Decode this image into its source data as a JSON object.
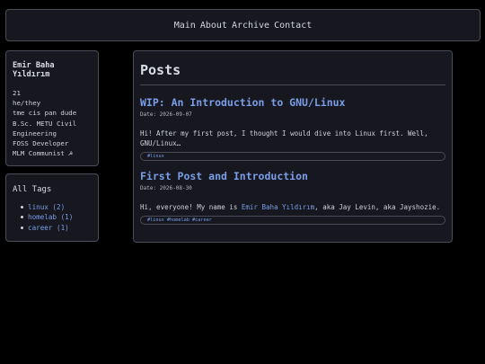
{
  "nav": {
    "links": [
      "Main",
      "About",
      "Archive",
      "Contact"
    ]
  },
  "profile": {
    "name": "Emir Baha Yıldırım",
    "lines": [
      "21",
      "he/they",
      "tme cis pan dude",
      "B.Sc. METU Civil",
      "Engineering",
      "FOSS Developer",
      "MLM Communist ☭"
    ]
  },
  "tags": {
    "heading": "All Tags",
    "items": [
      "linux (2)",
      "homelab (1)",
      "career (1)"
    ]
  },
  "main": {
    "title": "Posts",
    "posts": [
      {
        "title": "WIP: An Introduction to GNU/Linux",
        "date": "Date: 2026-09-07",
        "excerpt": "Hi! After my first post, I thought I would dive into Linux first. Well, GNU/Linux…",
        "tags": "#linux"
      },
      {
        "title": "First Post and Introduction",
        "date": "Date: 2026-08-30",
        "excerpt_before": "Hi, everyone! My name is ",
        "excerpt_link": "Emir Baha Yıldırım",
        "excerpt_after": ", aka Jay Levin, aka Jayshozie.",
        "tags": "#linux #homelab #career"
      }
    ]
  },
  "colors": {
    "background": "#000000",
    "panel": "#16171f",
    "border": "#4a4c5a",
    "accent": "#7a9ee8",
    "text": "#cfd1dc"
  }
}
